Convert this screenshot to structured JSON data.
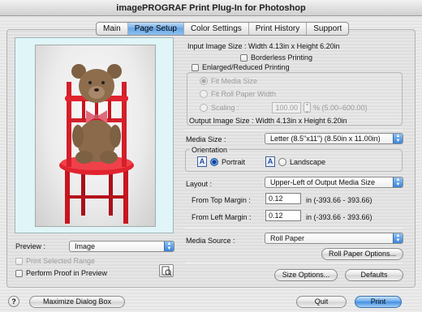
{
  "window": {
    "title": "imagePROGRAF Print Plug-In for Photoshop"
  },
  "tabs": [
    {
      "label": "Main",
      "active": false
    },
    {
      "label": "Page Setup",
      "active": true
    },
    {
      "label": "Color Settings",
      "active": false
    },
    {
      "label": "Print History",
      "active": false
    },
    {
      "label": "Support",
      "active": false
    }
  ],
  "input_image_size": "Input Image Size : Width 4.13in x Height 6.20in",
  "borderless": {
    "label": "Borderless Printing",
    "checked": false
  },
  "enlarged": {
    "label": "Enlarged/Reduced Printing",
    "checked": false,
    "fit_media": "Fit Media Size",
    "fit_roll": "Fit Roll Paper Width",
    "scaling_label": "Scaling :",
    "scaling_value": "100.00",
    "scaling_range": "% (5.00–600.00)"
  },
  "output_image_size": "Output Image Size : Width 4.13in x Height 6.20in",
  "media_size": {
    "label": "Media Size :",
    "value": "Letter (8.5\"x11\") (8.50in x 11.00in)"
  },
  "orientation": {
    "label": "Orientation",
    "portrait": "Portrait",
    "landscape": "Landscape",
    "icon_letter": "A"
  },
  "layout": {
    "label": "Layout :",
    "value": "Upper-Left of Output Media Size",
    "top_margin_label": "From Top Margin :",
    "top_margin_value": "0.12",
    "top_margin_unit": "in  (-393.66 - 393.66)",
    "left_margin_label": "From Left Margin :",
    "left_margin_value": "0.12",
    "left_margin_unit": "in  (-393.66 - 393.66)"
  },
  "media_source": {
    "label": "Media Source :",
    "value": "Roll Paper",
    "options_button": "Roll Paper Options..."
  },
  "preview": {
    "label": "Preview :",
    "value": "Image",
    "print_selected_range": "Print Selected Range",
    "perform_proof": "Perform Proof in Preview"
  },
  "buttons": {
    "size_options": "Size Options...",
    "defaults": "Defaults",
    "maximize": "Maximize Dialog Box",
    "quit": "Quit",
    "print": "Print",
    "help": "?"
  },
  "colors": {
    "accent": "#3f8de0",
    "preview_bg": "#dff5f8",
    "chair_red": "#d41f2a"
  }
}
